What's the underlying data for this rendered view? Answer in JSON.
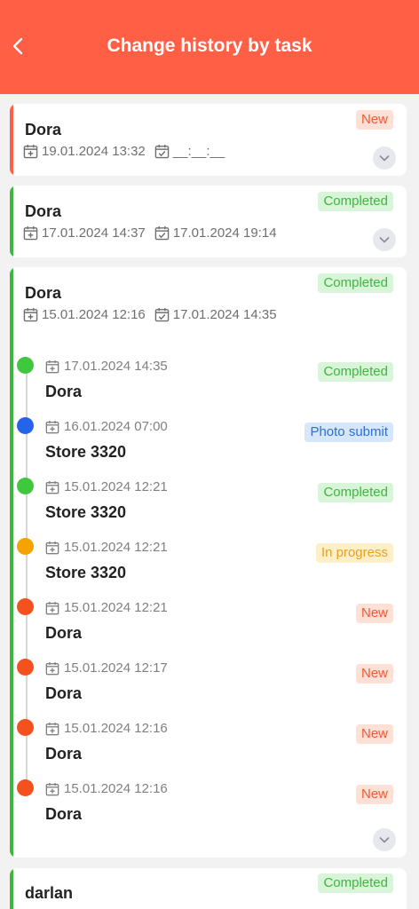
{
  "header": {
    "title": "Change history by task"
  },
  "colors": {
    "header": "#ff5f45",
    "new": "#ef5a32",
    "completed": "#3fb63f",
    "photo_submit": "#2d6fd6",
    "in_progress": "#f5a300"
  },
  "cards": [
    {
      "name": "Dora",
      "status": "New",
      "start": "19.01.2024 13:32",
      "end": "__:__:__"
    },
    {
      "name": "Dora",
      "status": "Completed",
      "start": "17.01.2024 14:37",
      "end": "17.01.2024 19:14"
    },
    {
      "name": "Dora",
      "status": "Completed",
      "start": "15.01.2024 12:16",
      "end": "17.01.2024 14:35",
      "history": [
        {
          "time": "17.01.2024 14:35",
          "name": "Dora",
          "status": "Completed"
        },
        {
          "time": "16.01.2024 07:00",
          "name": "Store 3320",
          "status": "Photo submit"
        },
        {
          "time": "15.01.2024 12:21",
          "name": "Store 3320",
          "status": "Completed"
        },
        {
          "time": "15.01.2024 12:21",
          "name": "Store 3320",
          "status": "In progress"
        },
        {
          "time": "15.01.2024 12:21",
          "name": "Dora",
          "status": "New"
        },
        {
          "time": "15.01.2024 12:17",
          "name": "Dora",
          "status": "New"
        },
        {
          "time": "15.01.2024 12:16",
          "name": "Dora",
          "status": "New"
        },
        {
          "time": "15.01.2024 12:16",
          "name": "Dora",
          "status": "New"
        }
      ]
    },
    {
      "name": "darlan",
      "status": "Completed"
    }
  ]
}
